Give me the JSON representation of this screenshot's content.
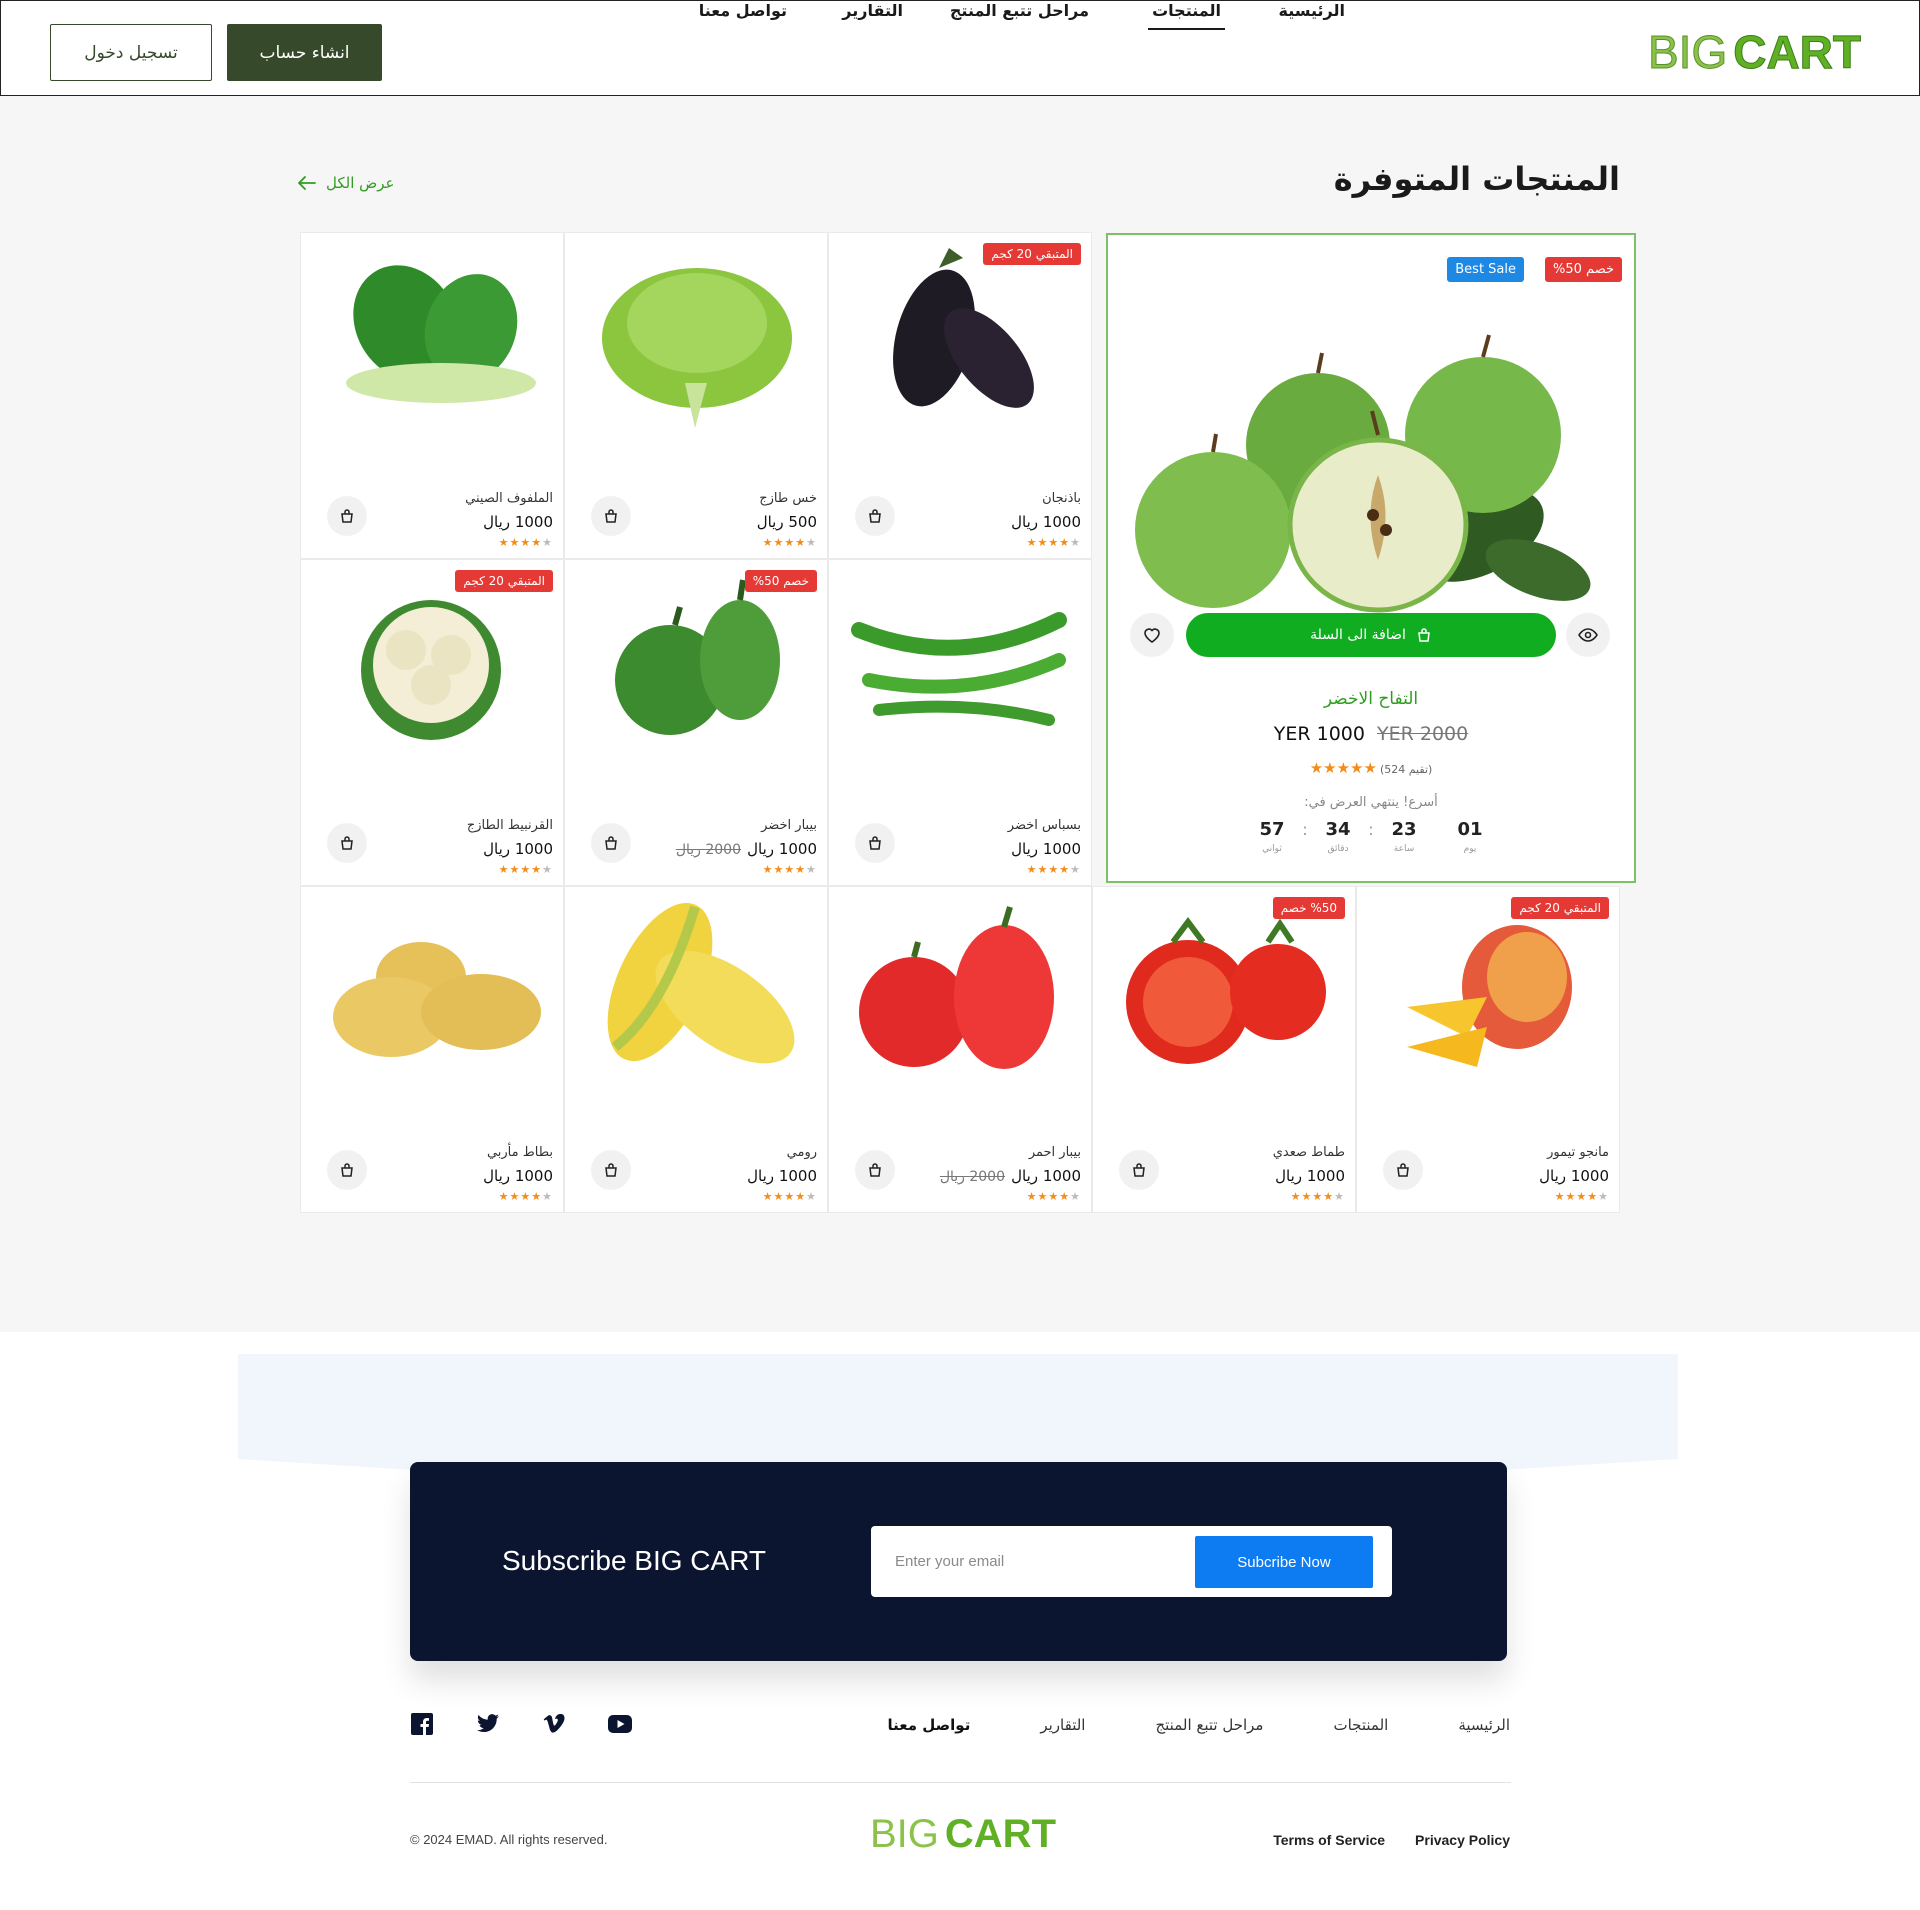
{
  "header": {
    "logo_big": "BIG",
    "logo_cart": "CART",
    "nav": [
      {
        "label": "الرئيسية"
      },
      {
        "label": "المنتجات"
      },
      {
        "label": "مراحل تتبع المنتج"
      },
      {
        "label": "التقارير"
      },
      {
        "label": "تواصل معنا"
      }
    ],
    "active_nav": "المنتجات",
    "signup_label": "انشاء حساب",
    "login_label": "تسجيل دخول"
  },
  "main": {
    "title": "المنتجات المتوفرة",
    "view_all": "عرض الكل"
  },
  "featured": {
    "badge_discount": "خصم 50%",
    "badge_best": "Best Sale",
    "add_to_cart": "اضافة الى السلة",
    "name": "التفاح الاخضر",
    "price": "YER 1000",
    "old_price": "YER 2000",
    "stars": "★★★★★",
    "rating_count": "(524 تقيم)",
    "hurry": "أسرع! ينتهي العرض في:",
    "timer": [
      {
        "value": "01",
        "label": "يوم"
      },
      {
        "value": "23",
        "label": "ساعة"
      },
      {
        "value": "34",
        "label": "دقائق"
      },
      {
        "value": "57",
        "label": "ثواني"
      }
    ]
  },
  "products": [
    {
      "name": "باذنجان",
      "price": "1000 ريال",
      "badge": "المتبقي 20 كجم",
      "image": "eggplant",
      "rating": 4
    },
    {
      "name": "خس طازج",
      "price": "500 ريال",
      "image": "lettuce",
      "rating": 4
    },
    {
      "name": "الملفوف الصيني",
      "price": "1000 ريال",
      "image": "bok-choy",
      "rating": 4
    },
    {
      "name": "بسباس اخضر",
      "price": "1000 ريال",
      "image": "green-chili",
      "rating": 4
    },
    {
      "name": "بيبار اخضر",
      "price": "1000 ريال",
      "old_price": "2000 ريال",
      "badge": "خصم 50%",
      "image": "green-pepper",
      "rating": 4
    },
    {
      "name": "القرنبيط الطازج",
      "price": "1000 ريال",
      "badge": "المتبقي 20 كجم",
      "image": "cauliflower",
      "rating": 4
    },
    {
      "name": "مانجو تيمور",
      "price": "1000 ريال",
      "badge": "المتبقي 20 كجم",
      "image": "mango",
      "rating": 4
    },
    {
      "name": "طماط صعدي",
      "price": "1000 ريال",
      "badge": "%50 خصم",
      "image": "tomato",
      "rating": 4
    },
    {
      "name": "بيبار احمر",
      "price": "1000 ريال",
      "old_price": "2000 ريال",
      "image": "red-pepper",
      "rating": 4
    },
    {
      "name": "رومي",
      "price": "1000 ريال",
      "image": "corn",
      "rating": 4
    },
    {
      "name": "بطاط مأربي",
      "price": "1000 ريال",
      "image": "potato",
      "rating": 4
    }
  ],
  "subscribe": {
    "title": "Subscribe BIG CART",
    "placeholder": "Enter your email",
    "button": "Subcribe Now"
  },
  "footer": {
    "links": [
      {
        "label": "الرئيسية"
      },
      {
        "label": "المنتجات"
      },
      {
        "label": "مراحل تتبع المنتج"
      },
      {
        "label": "التقارير"
      },
      {
        "label": "تواصل معنا"
      }
    ],
    "social": [
      "facebook-icon",
      "twitter-icon",
      "vimeo-icon",
      "youtube-icon"
    ],
    "copyright": "© 2024 EMAD. All rights reserved.",
    "logo_big": "BIG",
    "logo_cart": "CART",
    "terms": "Terms of Service",
    "privacy": "Privacy Policy"
  },
  "colors": {
    "brand_green": "#5fb025",
    "dark_green": "#364a2b",
    "action_green": "#0fad1f",
    "badge_red": "#e53935",
    "badge_blue": "#1e88e5",
    "navy": "#0b1530",
    "subscribe_blue": "#0d7cf2"
  }
}
